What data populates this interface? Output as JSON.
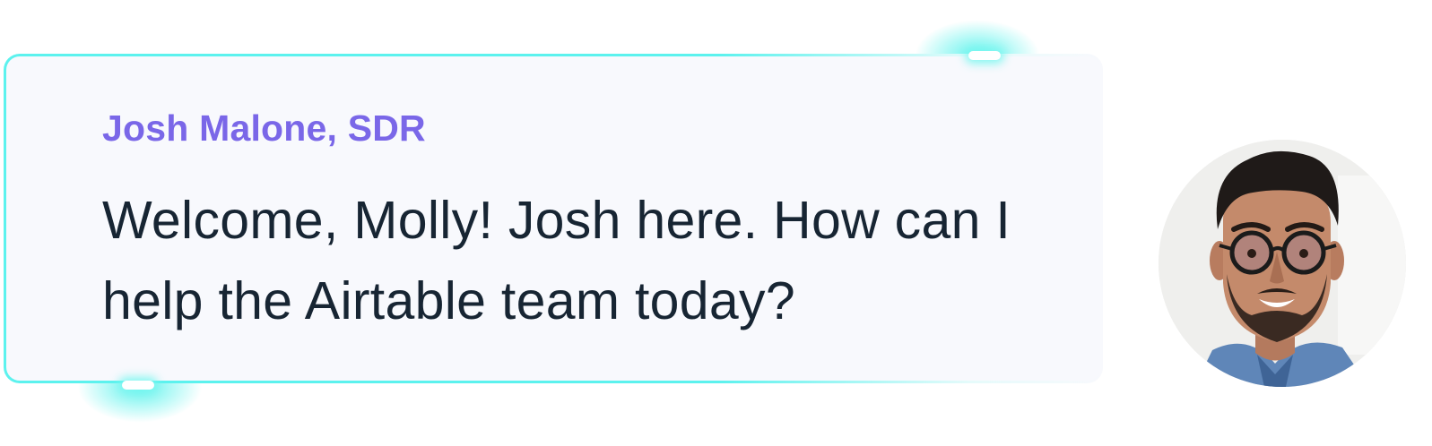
{
  "message": {
    "sender": "Josh Malone, SDR",
    "text": "Welcome, Molly! Josh here. How can I help the Airtable team today?"
  },
  "avatar": {
    "description_icon": "person-avatar"
  },
  "colors": {
    "accent_glow": "#5cf2ee",
    "sender_name": "#7a67e8",
    "message_text": "#172533",
    "card_background": "#f8f9fd"
  }
}
